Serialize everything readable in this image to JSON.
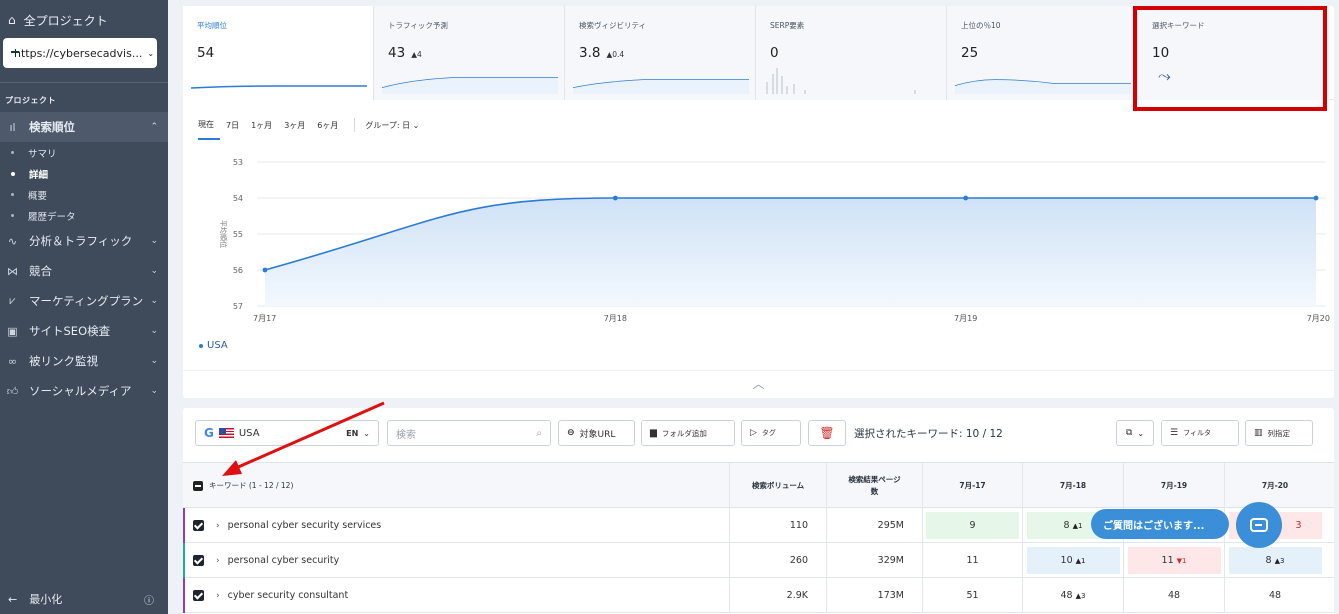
{
  "sidebar": {
    "all_projects": "全プロジェクト",
    "project_url": "https://cybersecadvis...",
    "section_label": "プロジェクト",
    "active_item": "検索順位",
    "sub_items": [
      "サマリ",
      "詳細",
      "概要",
      "履歴データ"
    ],
    "items": [
      "分析＆トラフィック",
      "競合",
      "マーケティングプラン",
      "サイトSEO検査",
      "被リンク監視",
      "ソーシャルメディア"
    ],
    "minimize": "最小化"
  },
  "metrics": [
    {
      "label": "平均順位",
      "value": "54",
      "delta": ""
    },
    {
      "label": "トラフィック予測",
      "value": "43",
      "delta": "▲4"
    },
    {
      "label": "検索ヴィジビリティ",
      "value": "3.8",
      "delta": "▲0.4"
    },
    {
      "label": "SERP要素",
      "value": "0",
      "delta": ""
    },
    {
      "label": "上位の％10",
      "value": "25",
      "delta": ""
    },
    {
      "label": "選択キーワード",
      "value": "10",
      "delta": ""
    }
  ],
  "timeline": {
    "tabs": [
      "現在",
      "7日",
      "1ヶ月",
      "3ヶ月",
      "6ヶ月"
    ],
    "group": "グループ: 日"
  },
  "chart_data": {
    "type": "line",
    "x": [
      "7月17",
      "7月18",
      "7月19",
      "7月20"
    ],
    "series": [
      {
        "name": "USA",
        "values": [
          56,
          54,
          54,
          54
        ]
      }
    ],
    "ylabel": "平均順位",
    "yticks": [
      53,
      54,
      55,
      56,
      57
    ],
    "ylim": [
      57,
      53
    ],
    "y_inverted": true,
    "grid": true,
    "legend_position": "bottom-left",
    "color": "#2c7bd6"
  },
  "toolbar": {
    "engine": "G",
    "country": "USA",
    "lang": "EN",
    "search_placeholder": "検索",
    "target_url": "対象URL",
    "add_folder": "フォルダ追加",
    "tag": "タグ",
    "selected": "選択されたキーワード: 10 / 12",
    "filter": "フィルタ",
    "columns": "列指定"
  },
  "table": {
    "header_keyword": "キーワード (1 - 12 / 12)",
    "header_volume": "検索ボリューム",
    "header_results_1": "検索結果ページ",
    "header_results_2": "数",
    "dates": [
      "7月-17",
      "7月-18",
      "7月-19",
      "7月-20"
    ],
    "rows": [
      {
        "keyword": "personal cyber security services",
        "volume": "110",
        "results": "295M",
        "p1": "9",
        "p2": "8",
        "p2d": "▲1",
        "p3": "",
        "p4": "3",
        "bar": "#8a3fb5"
      },
      {
        "keyword": "personal cyber security",
        "volume": "260",
        "results": "329M",
        "p1": "11",
        "p2": "10",
        "p2d": "▲1",
        "p3": "11",
        "p3d": "▼1",
        "p4": "8",
        "p4d": "▲3",
        "bar": "#1ea89a"
      },
      {
        "keyword": "cyber security consultant",
        "volume": "2.9K",
        "results": "173M",
        "p1": "51",
        "p2": "48",
        "p2d": "▲3",
        "p3": "48",
        "p4": "48",
        "bar": "#8a3fb5"
      }
    ]
  },
  "chat": {
    "text": "ご質問はございます..."
  }
}
